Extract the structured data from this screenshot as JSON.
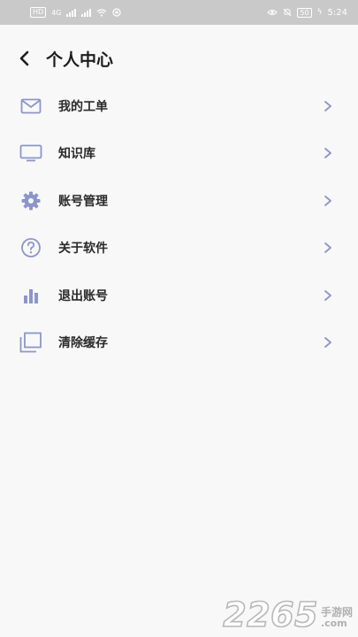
{
  "status_bar": {
    "network": "HD",
    "signal_1": "4G",
    "signal_2": "",
    "battery": "50",
    "time": "5:24"
  },
  "header": {
    "title": "个人中心",
    "back_icon": "back-arrow-icon"
  },
  "menu": {
    "items": [
      {
        "label": "我的工单",
        "icon": "mail-icon"
      },
      {
        "label": "知识库",
        "icon": "monitor-icon"
      },
      {
        "label": "账号管理",
        "icon": "gear-icon"
      },
      {
        "label": "关于软件",
        "icon": "question-circle-icon"
      },
      {
        "label": "退出账号",
        "icon": "bar-chart-icon"
      },
      {
        "label": "清除缓存",
        "icon": "layers-icon"
      }
    ]
  },
  "colors": {
    "icon": "#8c96c8",
    "chevron": "#8c96c8",
    "status_bar_bg": "#c9c9c9",
    "page_bg": "#f8f8f8"
  },
  "watermark": {
    "number": "2265",
    "suffix_cn": "手游网",
    "suffix_domain": ".com"
  }
}
